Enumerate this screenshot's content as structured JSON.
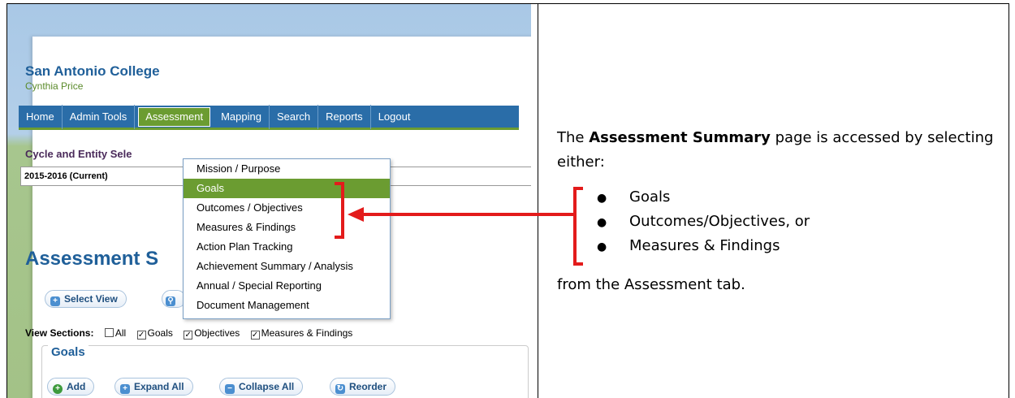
{
  "screenshot": {
    "org_name": "San Antonio College",
    "user_name": "Cynthia Price",
    "nav": [
      "Home",
      "Admin Tools",
      "Assessment",
      "Mapping",
      "Search",
      "Reports",
      "Logout"
    ],
    "active_nav": "Assessment",
    "cycle_label": "Cycle and Entity Sele",
    "cycle_value": "2015-2016  (Current)",
    "page_heading": "Assessment S",
    "select_view": "Select View",
    "view_sections": {
      "label": "View Sections:",
      "options": [
        "All",
        "Goals",
        "Objectives",
        "Measures & Findings"
      ]
    },
    "goals_title": "Goals",
    "goal_buttons": [
      "Add",
      "Expand All",
      "Collapse All",
      "Reorder"
    ],
    "dropdown": [
      "Mission / Purpose",
      "Goals",
      "Outcomes / Objectives",
      "Measures & Findings",
      "Action Plan Tracking",
      "Achievement Summary / Analysis",
      "Annual / Special Reporting",
      "Document Management"
    ],
    "highlighted_item": "Goals",
    "colors": {
      "nav_blue": "#2a6da8",
      "accent_green": "#6b9c31",
      "annotation_red": "#e31b1b"
    }
  },
  "description": {
    "prefix": "The ",
    "bold": "Assessment Summary",
    "suffix": " page is accessed by selecting either:",
    "bullets": [
      "Goals",
      "Outcomes/Objectives, or",
      "Measures & Findings"
    ],
    "tail": "from the Assessment tab."
  }
}
